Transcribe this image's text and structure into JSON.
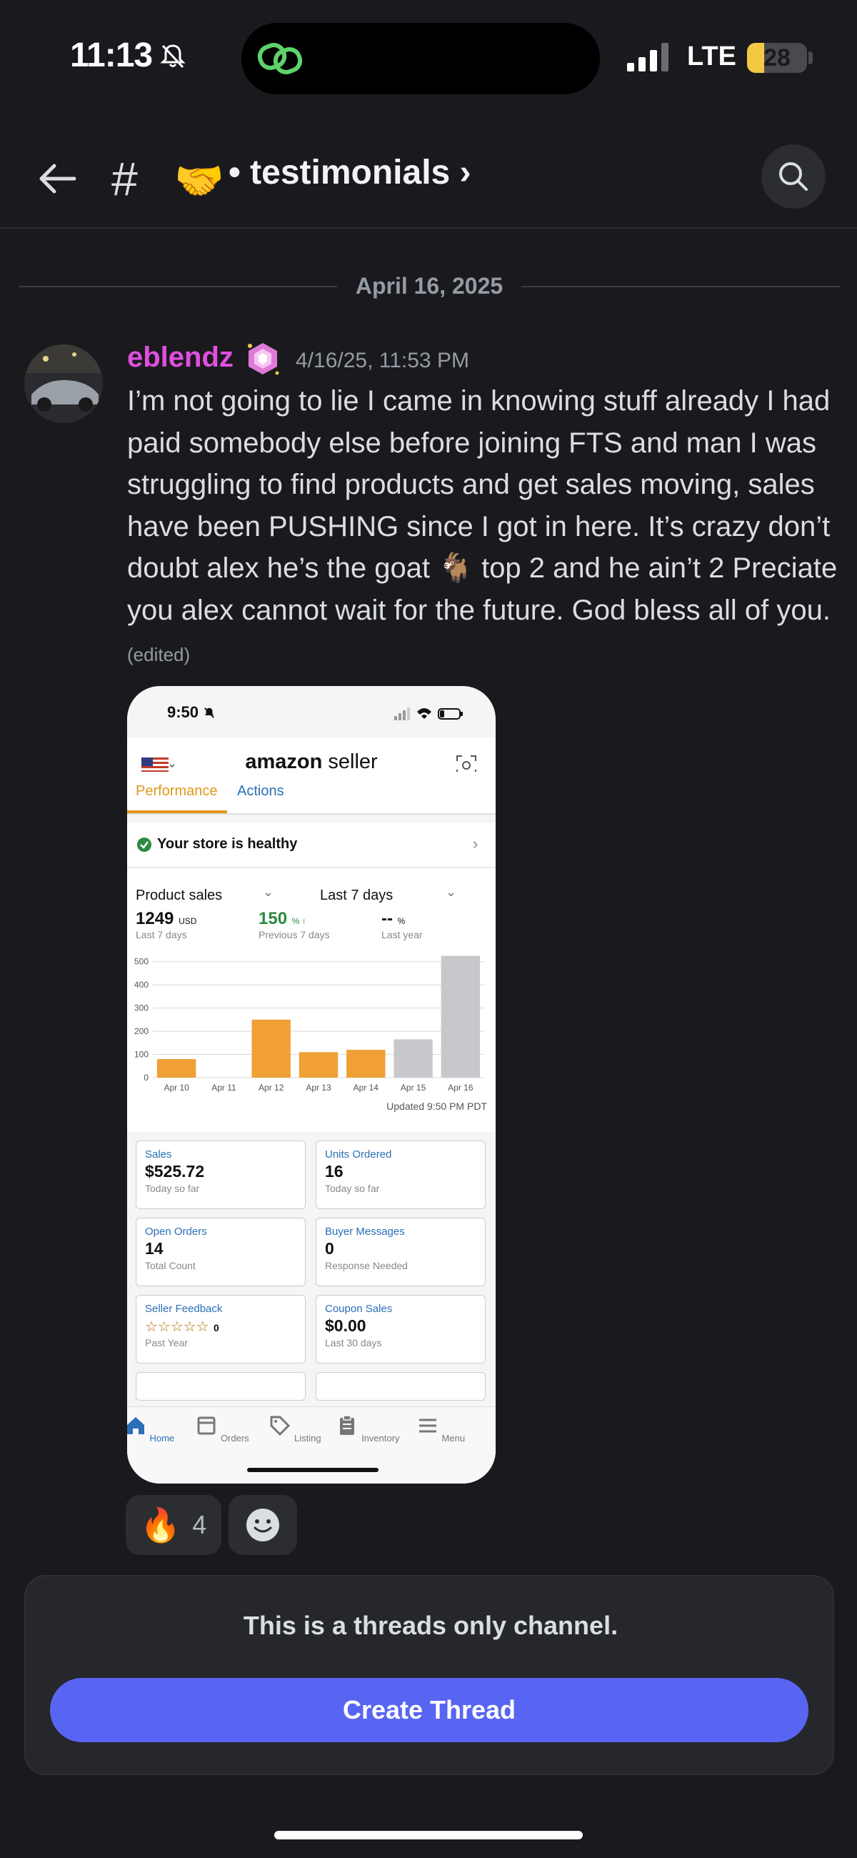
{
  "status": {
    "time": "11:13",
    "network": "LTE",
    "battery": "28",
    "battery_level": 0.28
  },
  "header": {
    "hash": "#",
    "channel_emoji": "🤝",
    "channel_name": "• testimonials ›"
  },
  "date_divider": "April 16, 2025",
  "message": {
    "username": "eblendz",
    "timestamp": "4/16/25, 11:53 PM",
    "text": "I’m not going to lie I came in knowing stuff already I had paid somebody else before joining FTS and man I was struggling to find products and get sales moving, sales have been PUSHING since I got in here. It’s crazy don’t doubt alex he’s the goat 🐐 top 2 and he ain’t 2 Preciate you alex cannot wait for the future. God bless all of you.",
    "edited": "(edited)"
  },
  "attachment": {
    "time": "9:50",
    "logo_main": "amazon",
    "logo_sub": " seller",
    "tabs": [
      "Performance",
      "Actions"
    ],
    "health": "Your store is healthy",
    "dropdown_metric": "Product sales",
    "dropdown_range": "Last 7 days",
    "stats": [
      {
        "value": "1249",
        "unit": "USD",
        "sub": "Last 7 days"
      },
      {
        "value": "150",
        "unit": "% ↑",
        "sub": "Previous 7 days"
      },
      {
        "value": "--",
        "unit": "%",
        "sub": "Last year"
      }
    ],
    "updated": "Updated 9:50 PM PDT",
    "cards": [
      {
        "title": "Sales",
        "value": "$525.72",
        "sub": "Today so far"
      },
      {
        "title": "Units Ordered",
        "value": "16",
        "sub": "Today so far"
      },
      {
        "title": "Open Orders",
        "value": "14",
        "sub": "Total Count"
      },
      {
        "title": "Buyer Messages",
        "value": "0",
        "sub": "Response Needed"
      },
      {
        "title": "Seller Feedback",
        "value": "☆☆☆☆☆",
        "value_suffix": "0",
        "sub": "Past Year"
      },
      {
        "title": "Coupon Sales",
        "value": "$0.00",
        "sub": "Last 30 days"
      }
    ],
    "nav": [
      "Home",
      "Orders",
      "Listing",
      "Inventory",
      "Menu"
    ]
  },
  "chart_data": {
    "type": "bar",
    "categories": [
      "Apr 10",
      "Apr 11",
      "Apr 12",
      "Apr 13",
      "Apr 14",
      "Apr 15",
      "Apr 16"
    ],
    "values": [
      80,
      0,
      250,
      110,
      120,
      165,
      525
    ],
    "current_period": [
      true,
      true,
      true,
      true,
      true,
      false,
      false
    ],
    "yticks": [
      0,
      100,
      200,
      300,
      400,
      500
    ],
    "ylim": [
      0,
      530
    ],
    "colors": {
      "current": "#f0a035",
      "previous": "#c8c8cc"
    }
  },
  "reactions": [
    {
      "emoji": "🔥",
      "count": "4"
    }
  ],
  "threads": {
    "notice": "This is a threads only channel.",
    "button": "Create Thread"
  },
  "colors": {
    "accent": "#5865f2",
    "username": "#e04fe0",
    "background": "#1a1a1e"
  }
}
